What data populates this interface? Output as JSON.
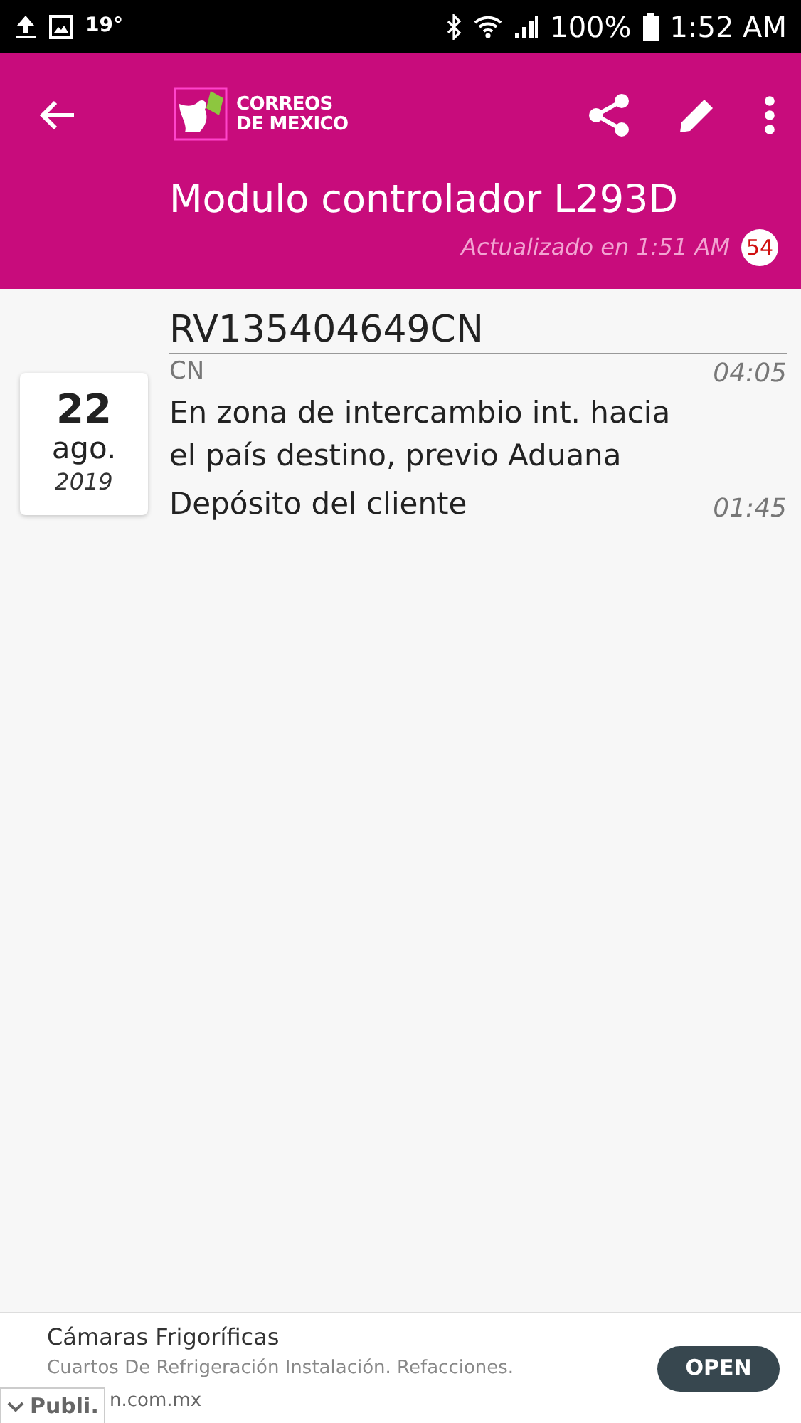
{
  "status_bar": {
    "temperature": "19°",
    "battery": "100%",
    "time": "1:52 AM"
  },
  "app_bar": {
    "logo": [
      "CORREOS",
      "DE MEXICO"
    ],
    "title": "Modulo controlador L293D",
    "updated": "Actualizado en 1:51 AM",
    "count": "54"
  },
  "tracking": {
    "number": "RV135404649CN",
    "date": {
      "day": "22",
      "month": "ago.",
      "year": "2019"
    },
    "events": [
      {
        "place": "CN",
        "time": "04:05",
        "description": "En zona de intercambio int. hacia el país destino, previo Aduana"
      },
      {
        "time": "01:45",
        "description": "Depósito del cliente"
      }
    ]
  },
  "ad": {
    "title": "Cámaras Frigoríficas",
    "text": "Cuartos De Refrigeración Instalación. Refacciones.",
    "url": "n.com.mx",
    "button": "OPEN",
    "tag": "Publi."
  }
}
